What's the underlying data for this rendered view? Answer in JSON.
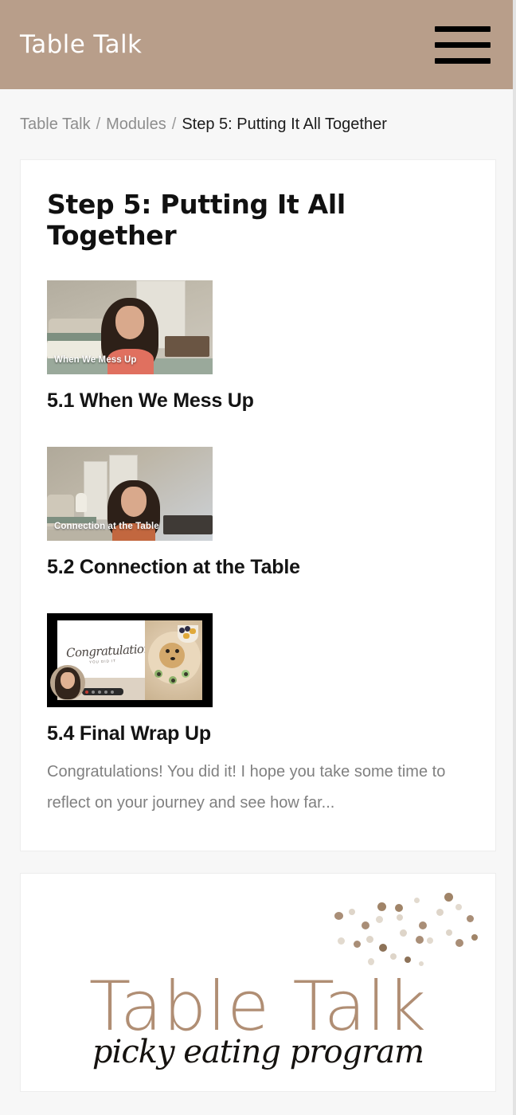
{
  "header": {
    "brand": "Table Talk",
    "menu_icon": "hamburger-menu-icon"
  },
  "breadcrumb": {
    "items": [
      {
        "label": "Table Talk",
        "current": false
      },
      {
        "label": "Modules",
        "current": false
      },
      {
        "label": "Step 5: Putting It All Together",
        "current": true
      }
    ],
    "separator": "/"
  },
  "main": {
    "page_title": "Step 5: Putting It All Together",
    "lessons": [
      {
        "title": "5.1 When We Mess Up",
        "thumbnail_caption": "When We Mess Up",
        "description": ""
      },
      {
        "title": "5.2 Connection at the Table",
        "thumbnail_caption": "Connection at the Table",
        "description": ""
      },
      {
        "title": "5.4 Final Wrap Up",
        "thumbnail_caption": "Congratulations",
        "thumbnail_caption_sub": "YOU DID IT",
        "description": "Congratulations! You did it! I hope you take some time to reflect on your journey and see how far..."
      }
    ]
  },
  "logo_card": {
    "title": "Table Talk",
    "subtitle": "picky eating program"
  },
  "colors": {
    "header_bg": "#b89e8a",
    "page_bg": "#f7f7f7",
    "card_bg": "#ffffff",
    "title_text": "#111111",
    "muted_text": "#808080",
    "breadcrumb_link": "#8d8d8d",
    "logo_brown": "#b08e74",
    "confetti_dark": "#a98e77",
    "confetti_light": "#e5ddd3"
  }
}
